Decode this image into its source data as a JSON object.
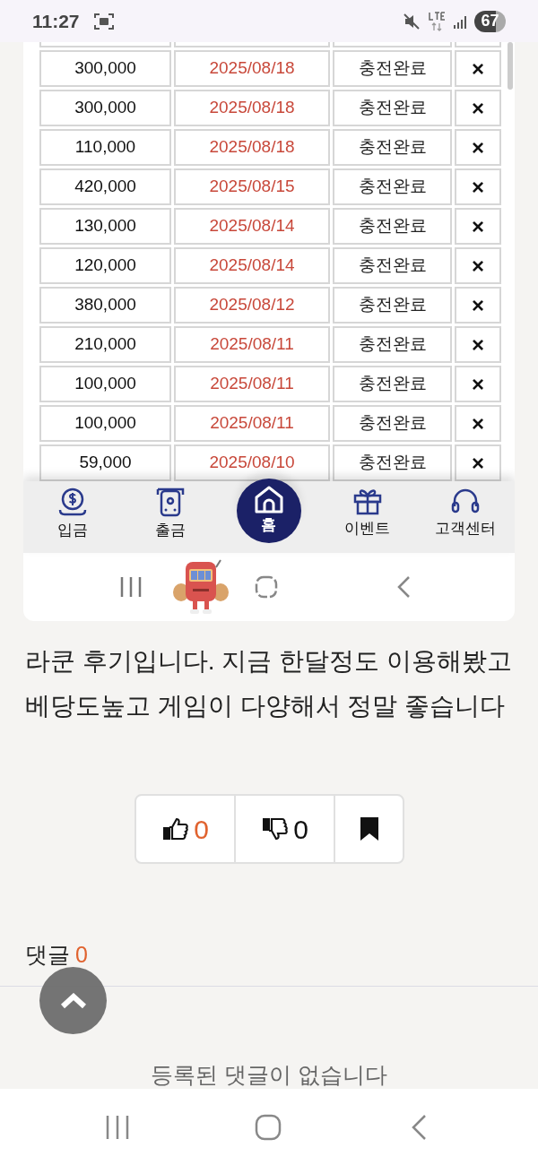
{
  "status_bar": {
    "time": "11:27",
    "battery": "67"
  },
  "embedded_screenshot": {
    "table": {
      "rows": [
        {
          "amount": "300,000",
          "date": "2025/08/18",
          "status": "충전완료",
          "action": "×"
        },
        {
          "amount": "300,000",
          "date": "2025/08/18",
          "status": "충전완료",
          "action": "×"
        },
        {
          "amount": "110,000",
          "date": "2025/08/18",
          "status": "충전완료",
          "action": "×"
        },
        {
          "amount": "420,000",
          "date": "2025/08/15",
          "status": "충전완료",
          "action": "×"
        },
        {
          "amount": "130,000",
          "date": "2025/08/14",
          "status": "충전완료",
          "action": "×"
        },
        {
          "amount": "120,000",
          "date": "2025/08/14",
          "status": "충전완료",
          "action": "×"
        },
        {
          "amount": "380,000",
          "date": "2025/08/12",
          "status": "충전완료",
          "action": "×"
        },
        {
          "amount": "210,000",
          "date": "2025/08/11",
          "status": "충전완료",
          "action": "×"
        },
        {
          "amount": "100,000",
          "date": "2025/08/11",
          "status": "충전완료",
          "action": "×"
        },
        {
          "amount": "100,000",
          "date": "2025/08/11",
          "status": "충전완료",
          "action": "×"
        },
        {
          "amount": "59,000",
          "date": "2025/08/10",
          "status": "충전완료",
          "action": "×"
        }
      ]
    },
    "nav": [
      {
        "label": "입금",
        "kind": "deposit",
        "selected": false
      },
      {
        "label": "출금",
        "kind": "withdraw",
        "selected": false
      },
      {
        "label": "홈",
        "kind": "home",
        "selected": true
      },
      {
        "label": "이벤트",
        "kind": "gift",
        "selected": false
      },
      {
        "label": "고객센터",
        "kind": "headset",
        "selected": false
      }
    ]
  },
  "post": {
    "text": "라쿤 후기입니다. 지금 한달정도 이용해봤고 베당도높고 게임이 다양해서 정말 좋습니다"
  },
  "reactions": {
    "likes": "0",
    "dislikes": "0"
  },
  "comments": {
    "label": "댓글",
    "count": "0",
    "empty_text": "등록된 댓글이 없습니다"
  }
}
